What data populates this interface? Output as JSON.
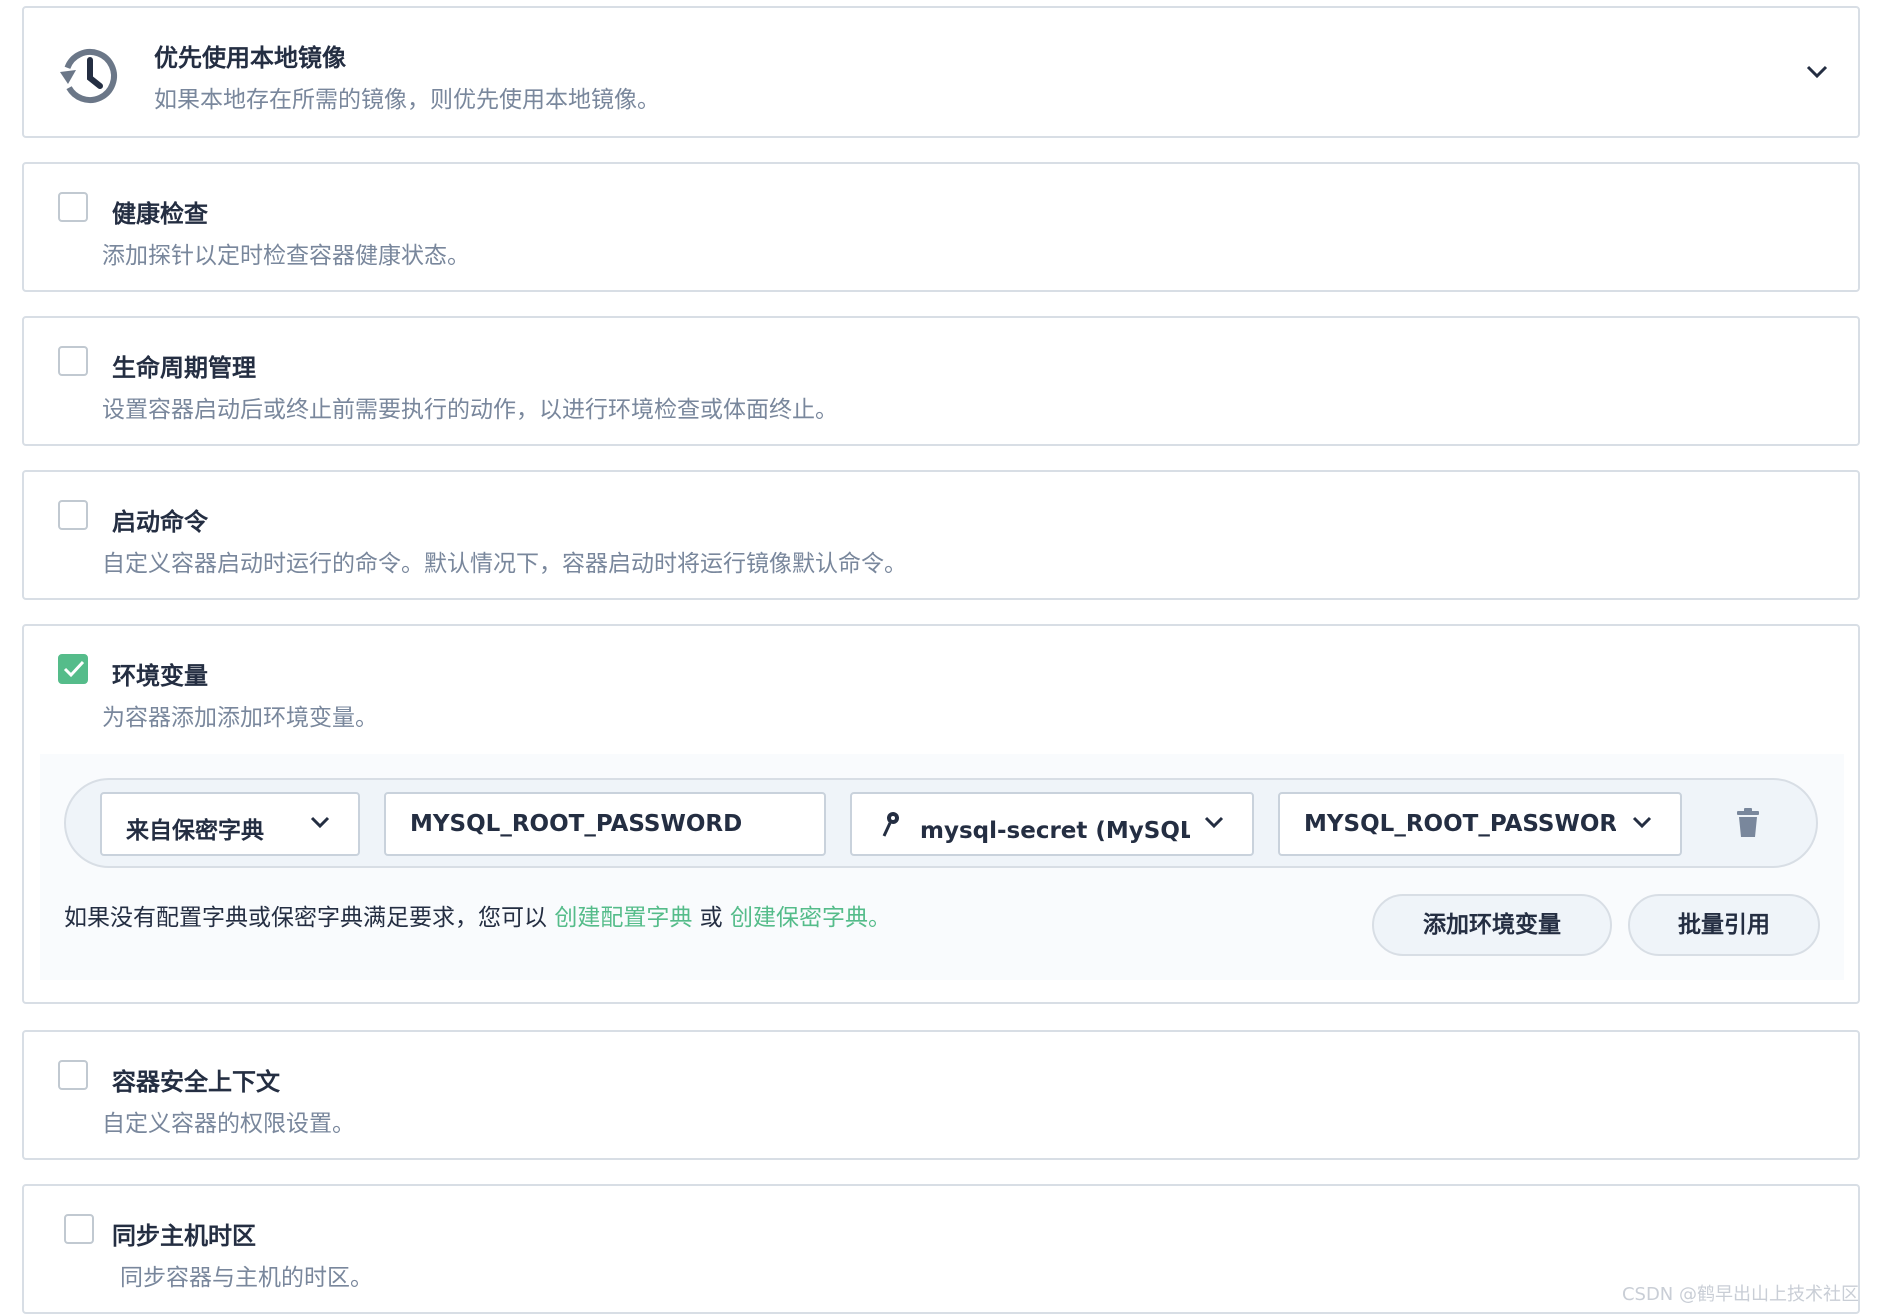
{
  "image_preference": {
    "title": "优先使用本地镜像",
    "description": "如果本地存在所需的镜像，则优先使用本地镜像。"
  },
  "sections": [
    {
      "key": "health",
      "title": "健康检查",
      "description": "添加探针以定时检查容器健康状态。",
      "checked": false
    },
    {
      "key": "lifecycle",
      "title": "生命周期管理",
      "description": "设置容器启动后或终止前需要执行的动作，以进行环境检查或体面终止。",
      "checked": false
    },
    {
      "key": "command",
      "title": "启动命令",
      "description": "自定义容器启动时运行的命令。默认情况下，容器启动时将运行镜像默认命令。",
      "checked": false
    },
    {
      "key": "env",
      "title": "环境变量",
      "description": "为容器添加添加环境变量。",
      "checked": true
    },
    {
      "key": "security",
      "title": "容器安全上下文",
      "description": "自定义容器的权限设置。",
      "checked": false
    },
    {
      "key": "timezone",
      "title": "同步主机时区",
      "description": "同步容器与主机的时区。",
      "checked": false
    }
  ],
  "env_var": {
    "source_type": "来自保密字典",
    "name_value": "MYSQL_ROOT_PASSWORD",
    "secret_select": "mysql-secret (MySQL 密",
    "key_select": "MYSQL_ROOT_PASSWORD"
  },
  "env_hint": {
    "text_before": "如果没有配置字典或保密字典满足要求，您可以",
    "link_config": "创建配置字典",
    "or_text": "或",
    "link_secret": "创建保密字典。"
  },
  "buttons": {
    "add_env": "添加环境变量",
    "batch_ref": "批量引用"
  },
  "watermark": "CSDN @鹤早出山上技术社区",
  "colors": {
    "accent": "#55bc8a",
    "border": "#d8dee5",
    "text": "#242e42",
    "muted": "#79879c"
  }
}
